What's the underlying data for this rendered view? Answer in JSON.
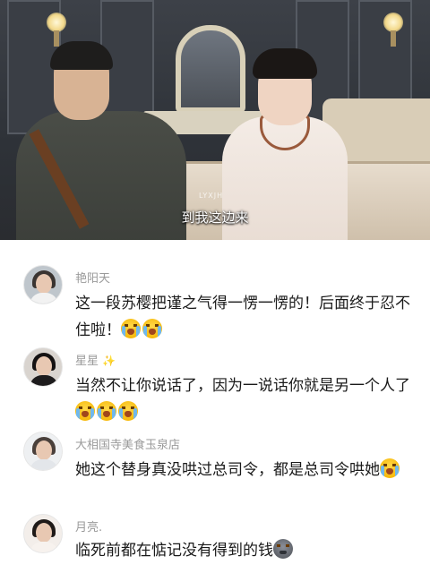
{
  "video": {
    "subtitle": "到我这边来",
    "watermark": "LYXJH"
  },
  "comments": [
    {
      "username": "艳阳天",
      "avatar": "avatar-woman-white-dress",
      "text": "这一段苏樱把谨之气得一愣一愣的！后面终于忍不住啦！",
      "emojis": [
        "crying-laugh-emoji",
        "crying-laugh-emoji"
      ]
    },
    {
      "username": "星星",
      "badge": "✨",
      "avatar": "avatar-woman-dark",
      "text": "当然不让你说话了，因为一说话你就是另一个人了",
      "emojis": [
        "crying-laugh-emoji",
        "crying-laugh-emoji",
        "crying-laugh-emoji"
      ]
    },
    {
      "username": "大相国寺美食玉泉店",
      "avatar": "avatar-woman-light",
      "text": "她这个替身真没哄过总司令，都是总司令哄她",
      "emojis": [
        "crying-laugh-emoji"
      ]
    },
    {
      "username": "月亮.",
      "avatar": "avatar-woman-smiling",
      "text": "临死前都在惦记没有得到的钱",
      "emojis": [
        "sad-dark-emoji"
      ]
    }
  ],
  "colors": {
    "username": "#9a9a9a",
    "text": "#1a1a1a",
    "subtitle": "#ffffff"
  }
}
